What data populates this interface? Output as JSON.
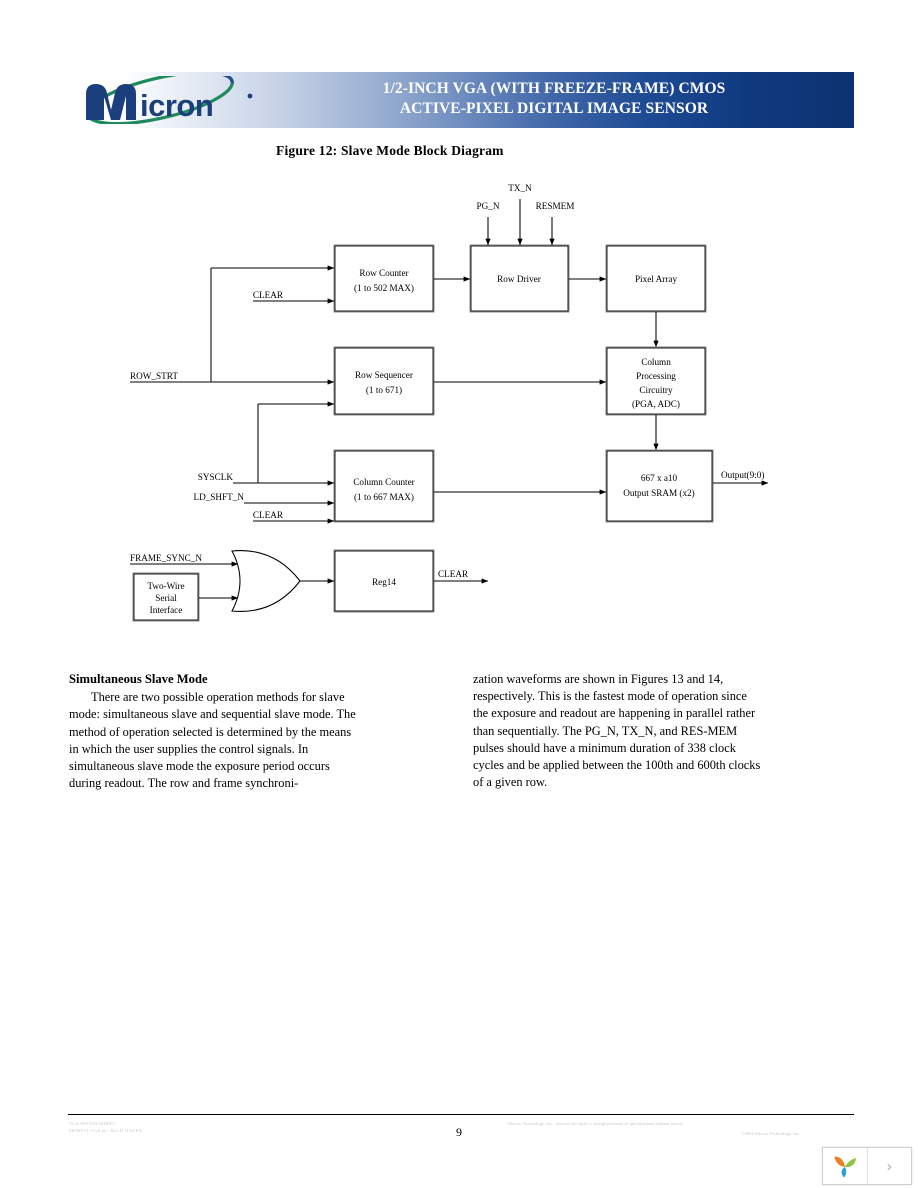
{
  "document": {
    "page_number": "9",
    "header": {
      "logo_text": "Micron",
      "title_line1": "1/2-INCH VGA (WITH FREEZE-FRAME) CMOS",
      "title_line2": "ACTIVE-PIXEL DIGITAL IMAGE SENSOR",
      "gradient_start": "#ffffff",
      "gradient_end": "#0d3271",
      "title_color": "#ffffff"
    },
    "figure": {
      "caption": "Figure 12:  Slave Mode Block Diagram",
      "blocks": [
        {
          "id": "row-counter",
          "lines": [
            "Row Counter",
            "(1 to 502 MAX)"
          ]
        },
        {
          "id": "row-driver",
          "lines": [
            "Row Driver"
          ]
        },
        {
          "id": "pixel-array",
          "lines": [
            "Pixel Array"
          ]
        },
        {
          "id": "row-sequencer",
          "lines": [
            "Row Sequencer",
            "(1 to 671)"
          ]
        },
        {
          "id": "column-processing",
          "lines": [
            "Column",
            "Processing",
            "Circuitry",
            "(PGA, ADC)"
          ]
        },
        {
          "id": "column-counter",
          "lines": [
            "Column Counter",
            "(1 to 667 MAX)"
          ]
        },
        {
          "id": "output-sram",
          "lines": [
            "667 x a10",
            "Output SRAM (x2)"
          ]
        },
        {
          "id": "two-wire",
          "lines": [
            "Two-Wire",
            "Serial",
            "Interface"
          ]
        },
        {
          "id": "reg14",
          "lines": [
            "Reg14"
          ]
        }
      ],
      "signals": {
        "tx_n": "TX_N",
        "pg_n": "PG_N",
        "resmem": "RESMEM",
        "clear_row_counter": "CLEAR",
        "row_strt": "ROW_STRT",
        "sysclk": "SYSCLK",
        "ld_shft_n": "LD_SHFT_N",
        "clear_column_counter": "CLEAR",
        "output_bus": "Output(9:0)",
        "frame_sync_n": "FRAME_SYNC_N",
        "clear_reg14": "CLEAR"
      }
    },
    "body": {
      "section_heading": "Simultaneous Slave Mode",
      "left_column": "There are two possible operation methods for slave mode: simultaneous slave and sequential slave mode. The method of operation selected is determined by the means in which the user supplies the control signals. In simultaneous slave mode the exposure period occurs during readout. The row and frame synchroni-",
      "right_column": "zation waveforms are shown in Figures 13 and 14, respectively. This is the fastest mode of operation since the exposure and readout are happening in parallel rather than sequentially. The PG_N, TX_N, and RES-MEM pulses should have a minimum duration of 338 clock cycles and be applied between the 100th and 600th clocks of a given row."
    },
    "footer": {
      "left_line1": "VGA APS DATASHEET",
      "left_line2": "MI-MV13_VGA.fm - Rev. D 11/04 EN",
      "middle": "Micron Technology, Inc., reserves the right to change products or specifications without notice.",
      "right": "©2004 Micron Technology, Inc."
    }
  },
  "viewer": {
    "logo_name": "leaf-logo",
    "next_label": "›"
  }
}
